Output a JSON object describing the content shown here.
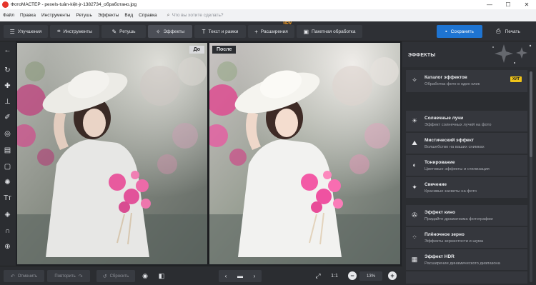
{
  "window": {
    "title": "ФотоМАСТЕР - pexels-tuân-kiệt-jr-1382734_обработано.jpg",
    "controls": [
      "—",
      "☐",
      "✕"
    ]
  },
  "menu": {
    "items": [
      "Файл",
      "Правка",
      "Инструменты",
      "Ретушь",
      "Эффекты",
      "Вид",
      "Справка"
    ],
    "search_placeholder": "Что вы хотите сделать?"
  },
  "toolbar": {
    "tabs": [
      {
        "label": "Улучшения",
        "icon": "sliders-icon"
      },
      {
        "label": "Инструменты",
        "icon": "crop-icon"
      },
      {
        "label": "Ретушь",
        "icon": "brush-icon"
      },
      {
        "label": "Эффекты",
        "icon": "magic-wand-icon",
        "active": true
      },
      {
        "label": "Текст и рамки",
        "icon": "text-icon"
      },
      {
        "label": "Расширения",
        "icon": "plus-icon",
        "badge": "NEW"
      },
      {
        "label": "Пакетная обработка",
        "icon": "batch-icon"
      }
    ],
    "save_label": "Сохранить",
    "print_label": "Печать",
    "accent_color": "#1e74d2"
  },
  "left_tools": [
    "back-arrow-icon",
    "rotate-icon",
    "healing-patch-icon",
    "stamp-icon",
    "brush-icon",
    "radial-filter-icon",
    "gradient-filter-icon",
    "vignette-icon",
    "light-icon",
    "text-icon",
    "fill-bucket-icon",
    "magnet-icon",
    "target-icon"
  ],
  "preview": {
    "before_label": "До",
    "after_label": "После"
  },
  "effects_panel": {
    "title": "ЭФФЕКТЫ",
    "catalog": {
      "name": "Каталог эффектов",
      "desc": "Обработка фото в один клик",
      "badge": "ХИТ",
      "icon": "magic-wand-icon"
    },
    "items": [
      {
        "name": "Солнечные лучи",
        "desc": "Эффект солнечных лучей на фото",
        "icon": "sun-icon"
      },
      {
        "name": "Мистический эффект",
        "desc": "Волшебство на ваших снимках",
        "icon": "mountain-icon"
      },
      {
        "name": "Тонирование",
        "desc": "Цветовые эффекты и стилизация",
        "icon": "half-circle-icon"
      },
      {
        "name": "Свечение",
        "desc": "Красивые засветы на фото",
        "icon": "sparkle-icon"
      },
      {
        "name": "Эффект кино",
        "desc": "Придайте драматизма фотографии",
        "icon": "film-reel-icon"
      },
      {
        "name": "Плёночное зерно",
        "desc": "Эффекты зернистости и шума",
        "icon": "grain-icon"
      },
      {
        "name": "Эффект HDR",
        "desc": "Расширение динамического диапазона",
        "icon": "hdr-icon"
      }
    ]
  },
  "bottom": {
    "undo_label": "Отменить",
    "redo_label": "Повторить",
    "reset_label": "Сбросить",
    "zoom_fit_label": "1:1",
    "zoom_value": "13%"
  }
}
